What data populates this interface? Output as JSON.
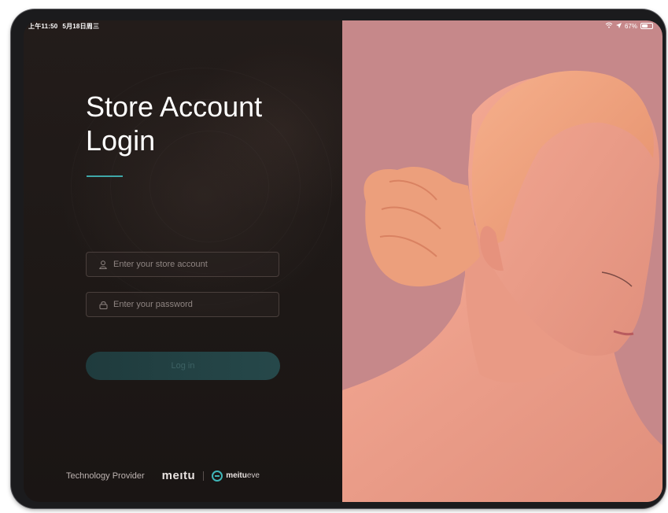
{
  "status_bar": {
    "time": "上午11:50",
    "date": "5月18日周三",
    "battery": "67%",
    "battery_level": 0.67
  },
  "login": {
    "title_line1": "Store Account",
    "title_line2": "Login",
    "account_placeholder": "Enter your store account",
    "password_placeholder": "Enter your password",
    "login_button": "Log in"
  },
  "footer": {
    "provider_label": "Technology Provider",
    "brand_meitu": "meıtu",
    "brand_eve_main": "meitu",
    "brand_eve_suffix": "eve"
  },
  "colors": {
    "accent": "#3fa7a8",
    "background": "#1e1a19",
    "photo_background": "#c6888a"
  },
  "icons": {
    "account": "user-icon",
    "password": "lock-icon",
    "wifi": "wifi-icon",
    "location": "location-arrow-icon",
    "battery": "battery-icon"
  }
}
